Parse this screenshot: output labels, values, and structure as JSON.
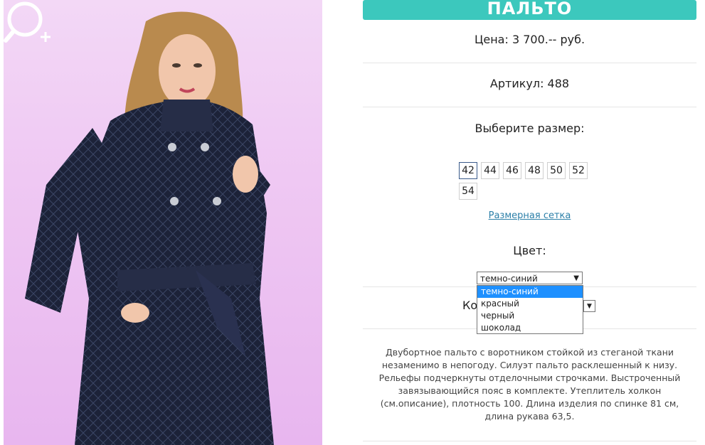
{
  "product": {
    "title": "ПАЛЬТО",
    "price": "Цена: 3 700.-- руб.",
    "article": "Артикул: 488",
    "size_prompt": "Выберите размер:",
    "sizes": [
      "42",
      "44",
      "46",
      "48",
      "50",
      "52",
      "54"
    ],
    "selected_size": "42",
    "size_chart_link": "Размерная сетка",
    "color_label": "Цвет:",
    "color_selected": "темно-синий",
    "color_options": [
      "темно-синий",
      "красный",
      "черный",
      "шоколад"
    ],
    "quantity_label": "Ко",
    "description": "Двубортное пальто с воротником стойкой из стеганой ткани незаменимо в непогоду. Силуэт пальто расклешенный к низу. Рельефы подчеркнуты отделочными строчками. Выстроченный завязывающийся пояс в комплекте. Утеплитель холкон (см.описание), плотность 100. Длина изделия по спинке 81 см, длина рукава 63,5."
  },
  "colors": {
    "accent": "#3cc8bd",
    "link": "#2b7fa8",
    "highlight": "#1e90ff"
  },
  "icons": {
    "zoom": "zoom-in-icon"
  }
}
